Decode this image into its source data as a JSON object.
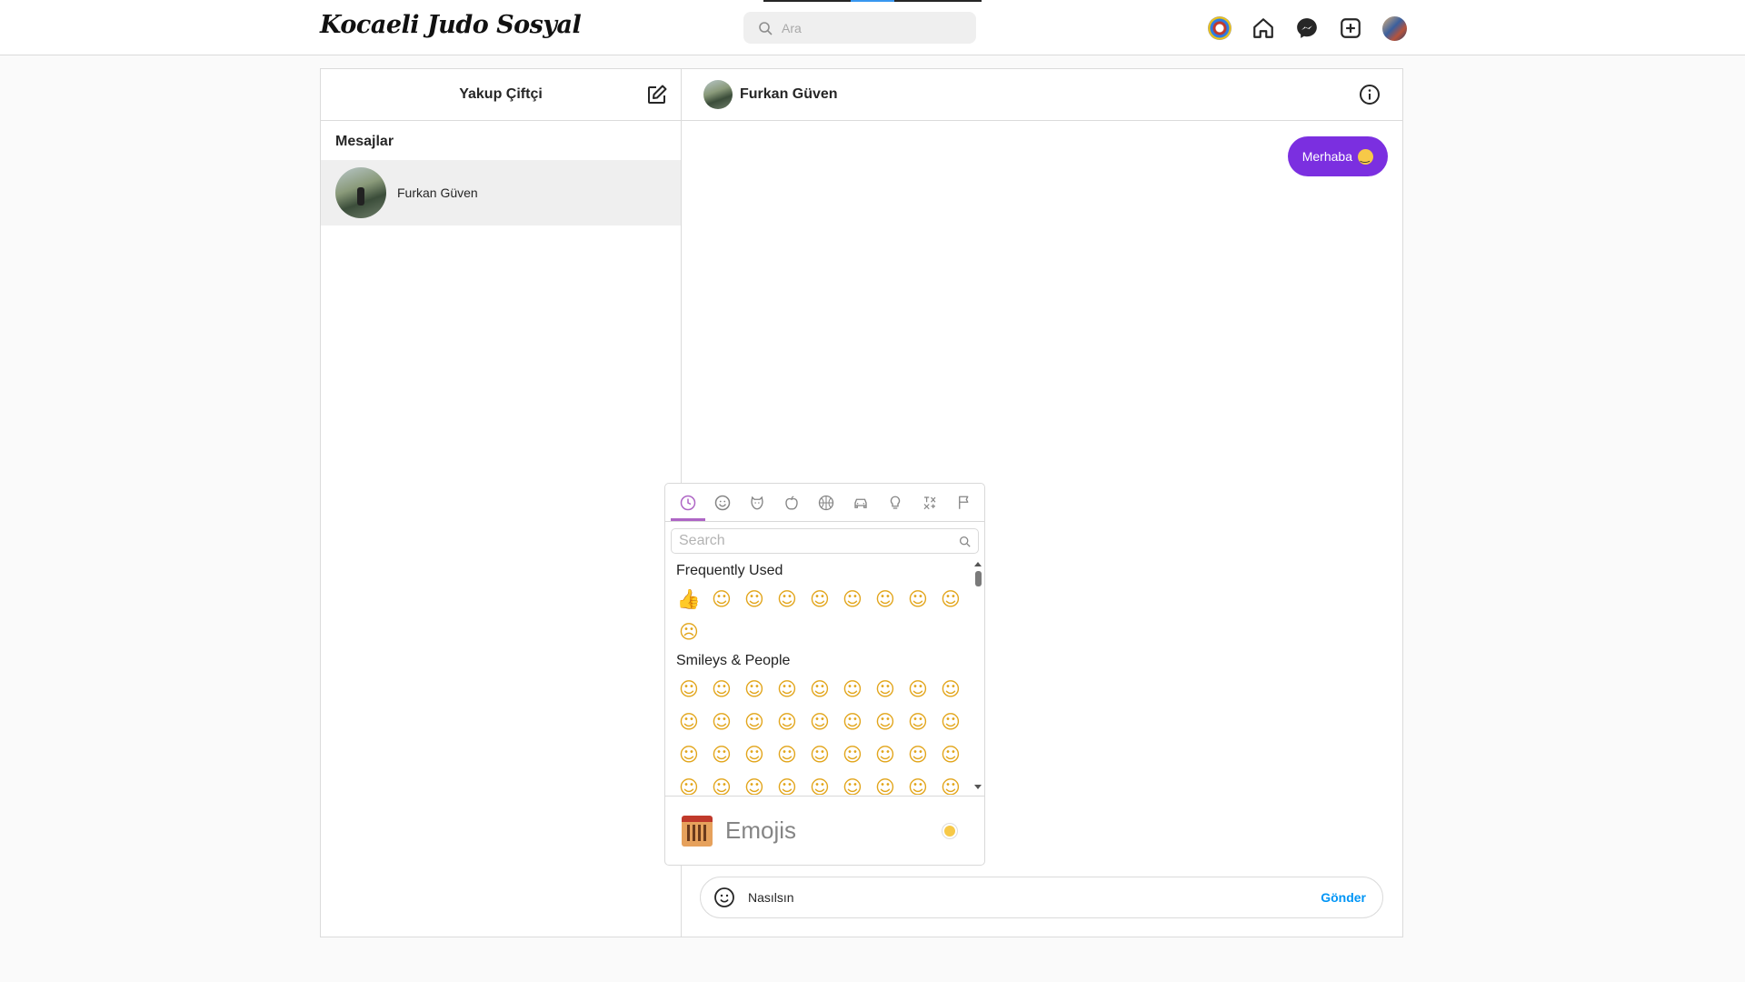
{
  "brand": "Kocaeli Judo Sosyal",
  "search": {
    "placeholder": "Ara"
  },
  "nav": {
    "icons": [
      "club-logo-icon",
      "home-icon",
      "messenger-icon",
      "add-post-icon",
      "profile-avatar"
    ]
  },
  "sidebar": {
    "username": "Yakup Çiftçi",
    "section_title": "Mesajlar",
    "conversations": [
      {
        "name": "Furkan Güven"
      }
    ]
  },
  "chat": {
    "contact_name": "Furkan Güven",
    "messages": [
      {
        "text": "Merhaba",
        "emoji": "slightly-smiling-face",
        "direction": "outgoing"
      }
    ],
    "composer": {
      "value": "Nasılsın",
      "send_label": "Gönder"
    }
  },
  "emoji_picker": {
    "categories": [
      "recent",
      "smileys",
      "nature",
      "foods",
      "activity",
      "places",
      "objects",
      "symbols",
      "flags"
    ],
    "active_category": "recent",
    "search_placeholder": "Search",
    "sections": [
      {
        "title": "Frequently Used"
      },
      {
        "title": "Smileys & People"
      }
    ],
    "preview_label": "Emojis",
    "accent": "#ae65c5"
  },
  "colors": {
    "bubble": "#7b2fe0",
    "send": "#0095f6"
  }
}
